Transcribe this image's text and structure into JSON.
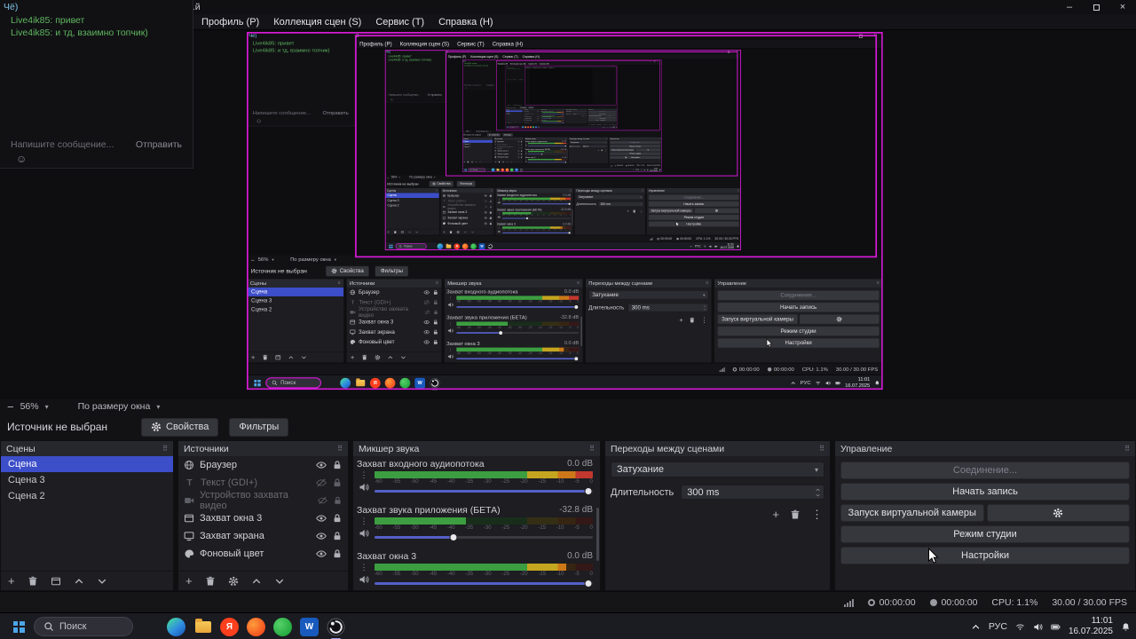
{
  "colors": {
    "magenta": "#d919d9",
    "selection": "#3d4ec9",
    "meter_green": "#3c9e40"
  },
  "icons": {
    "minimize": "–",
    "close": "×",
    "caret": "▾",
    "dots": "⋮",
    "grip": "⠿",
    "plus": "+",
    "minus": "−",
    "smiley": "☺",
    "text_type": "T",
    "yandex_letter": "Я",
    "word_letter": "W"
  },
  "chat": {
    "line_top": "Чё)",
    "messages": [
      "Live4ik85: привет",
      "Live4ik85: и тд, взаимно топчик)"
    ],
    "placeholder": "Напишите сообщение...",
    "send": "Отправить"
  },
  "obs": {
    "title_fragment": "...й",
    "menu": [
      "Профиль (P)",
      "Коллекция сцен (S)",
      "Сервис (T)",
      "Справка (H)"
    ],
    "zoom_level": "56%",
    "fit_mode": "По размеру окна",
    "no_source": "Источник не выбран",
    "properties_label": "Свойства",
    "filters_label": "Фильтры",
    "docks": {
      "scenes": {
        "title": "Сцены",
        "items": [
          "Сцена",
          "Сцена 3",
          "Сцена 2"
        ]
      },
      "sources": {
        "title": "Источники",
        "items": [
          {
            "label": "Браузер",
            "icon": "globe-icon",
            "visible": true
          },
          {
            "label": "Текст (GDI+)",
            "icon": "text-icon",
            "visible": false
          },
          {
            "label": "Устройство захвата видео",
            "icon": "camera-icon",
            "visible": false
          },
          {
            "label": "Захват окна 3",
            "icon": "window-icon",
            "visible": true
          },
          {
            "label": "Захват экрана",
            "icon": "display-icon",
            "visible": true
          },
          {
            "label": "Фоновый цвет",
            "icon": "palette-icon",
            "visible": true
          }
        ]
      },
      "mixer": {
        "title": "Микшер звука",
        "ticks": [
          "-60",
          "-55",
          "-50",
          "-45",
          "-40",
          "-35",
          "-30",
          "-25",
          "-20",
          "-15",
          "-10",
          "-5",
          "0"
        ],
        "channels": [
          {
            "name": "Захват входного аудиопотока",
            "db": "0.0 dB",
            "level": 1.0,
            "unlit": 0.0,
            "fader": 0.98
          },
          {
            "name": "Захват звука приложения (БЕТА)",
            "db": "-32.8 dB",
            "level": 0.42,
            "unlit": 0.58,
            "fader": 0.36
          },
          {
            "name": "Захват окна 3",
            "db": "0.0 dB",
            "level": 0.88,
            "unlit": 0.12,
            "fader": 0.98
          }
        ]
      },
      "transitions": {
        "title": "Переходы между сценами",
        "transition": "Затухание",
        "duration_label": "Длительность",
        "duration_value": "300 ms"
      },
      "controls": {
        "title": "Управление",
        "buttons": [
          "Соединение...",
          "Начать запись",
          "Запуск виртуальной камеры",
          "Режим студии",
          "Настройки"
        ]
      }
    },
    "status": {
      "stream": "00:00:00",
      "rec": "00:00:00",
      "cpu": "CPU: 1.1%",
      "fps": "30.00 / 30.00 FPS"
    }
  },
  "taskbar": {
    "search": "Поиск",
    "lang": "РУС",
    "time": "11:01",
    "date": "16.07.2025"
  }
}
